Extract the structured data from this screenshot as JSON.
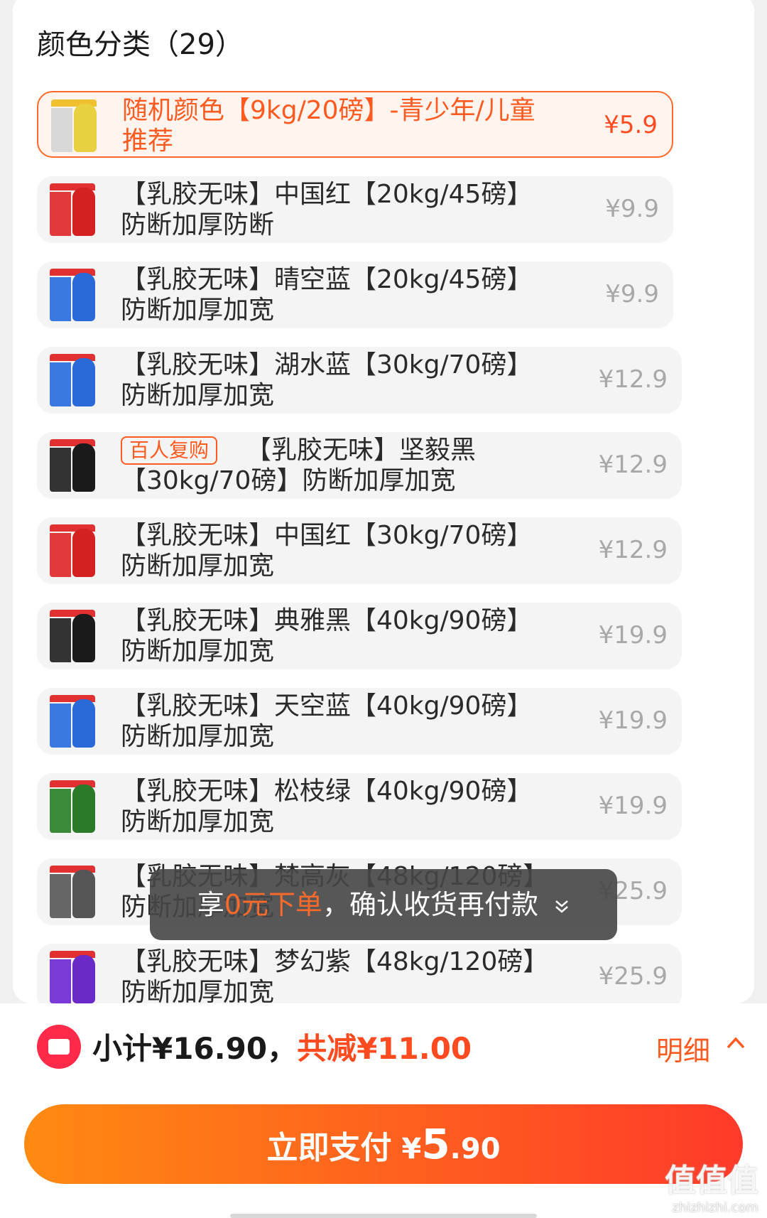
{
  "section": {
    "title": "颜色分类（29）"
  },
  "options": [
    {
      "label": "随机颜色【9kg/20磅】-青少年/儿童推荐",
      "price": "¥5.9",
      "selected": true,
      "badge": "",
      "thumb": {
        "top": "#f0c030",
        "body": "#d8d8d8",
        "band": "#e8d040"
      }
    },
    {
      "label": "【乳胶无味】中国红【20kg/45磅】防断加厚防断",
      "price": "¥9.9",
      "selected": false,
      "badge": "",
      "thumb": {
        "top": "#e03030",
        "body": "#e23a3a",
        "band": "#d42020"
      }
    },
    {
      "label": "【乳胶无味】晴空蓝【20kg/45磅】防断加厚加宽",
      "price": "¥9.9",
      "selected": false,
      "badge": "",
      "thumb": {
        "top": "#e03030",
        "body": "#3a7ae0",
        "band": "#2a6ad8"
      }
    },
    {
      "label": "【乳胶无味】湖水蓝【30kg/70磅】防断加厚加宽",
      "price": "¥12.9",
      "selected": false,
      "badge": "",
      "thumb": {
        "top": "#e03030",
        "body": "#3a7ae0",
        "band": "#2a6ad8"
      }
    },
    {
      "label": "【乳胶无味】坚毅黑【30kg/70磅】防断加厚加宽",
      "price": "¥12.9",
      "selected": false,
      "badge": "百人复购",
      "thumb": {
        "top": "#e03030",
        "body": "#333333",
        "band": "#1a1a1a"
      }
    },
    {
      "label": "【乳胶无味】中国红【30kg/70磅】防断加厚加宽",
      "price": "¥12.9",
      "selected": false,
      "badge": "",
      "thumb": {
        "top": "#e03030",
        "body": "#e23a3a",
        "band": "#d42020"
      }
    },
    {
      "label": "【乳胶无味】典雅黑【40kg/90磅】防断加厚加宽",
      "price": "¥19.9",
      "selected": false,
      "badge": "",
      "thumb": {
        "top": "#e03030",
        "body": "#333333",
        "band": "#1a1a1a"
      }
    },
    {
      "label": "【乳胶无味】天空蓝【40kg/90磅】防断加厚加宽",
      "price": "¥19.9",
      "selected": false,
      "badge": "",
      "thumb": {
        "top": "#e03030",
        "body": "#3a7ae0",
        "band": "#2a6ad8"
      }
    },
    {
      "label": "【乳胶无味】松枝绿【40kg/90磅】防断加厚加宽",
      "price": "¥19.9",
      "selected": false,
      "badge": "",
      "thumb": {
        "top": "#e03030",
        "body": "#3a8a3a",
        "band": "#2a7a2a"
      }
    },
    {
      "label": "【乳胶无味】梵高灰【48kg/120磅】防断加厚加宽",
      "price": "¥25.9",
      "selected": false,
      "badge": "",
      "thumb": {
        "top": "#e03030",
        "body": "#666666",
        "band": "#555555"
      }
    },
    {
      "label": "【乳胶无味】梦幻紫【48kg/120磅】防断加厚加宽",
      "price": "¥25.9",
      "selected": false,
      "badge": "",
      "thumb": {
        "top": "#e03030",
        "body": "#7a3ad8",
        "band": "#6a2ac8"
      }
    }
  ],
  "toast": {
    "prefix": "享",
    "highlight": "0元下单",
    "suffix": "，确认收货再付款",
    "icon": "chevron-down-double-icon"
  },
  "footer": {
    "subtotal": "小计¥16.90，",
    "discount": "共减¥11.00",
    "detail_label": "明细",
    "pay_label": "立即支付",
    "pay_currency": "¥",
    "pay_int": "5",
    "pay_dec": ".90"
  },
  "watermark": {
    "main": "值值值",
    "sub": "zhizhizhi.com"
  },
  "colors": {
    "accent": "#ff5a1f",
    "selected_bg": "#fff4ee",
    "pay_start": "#ff8a12",
    "pay_end": "#ff3a2a"
  }
}
